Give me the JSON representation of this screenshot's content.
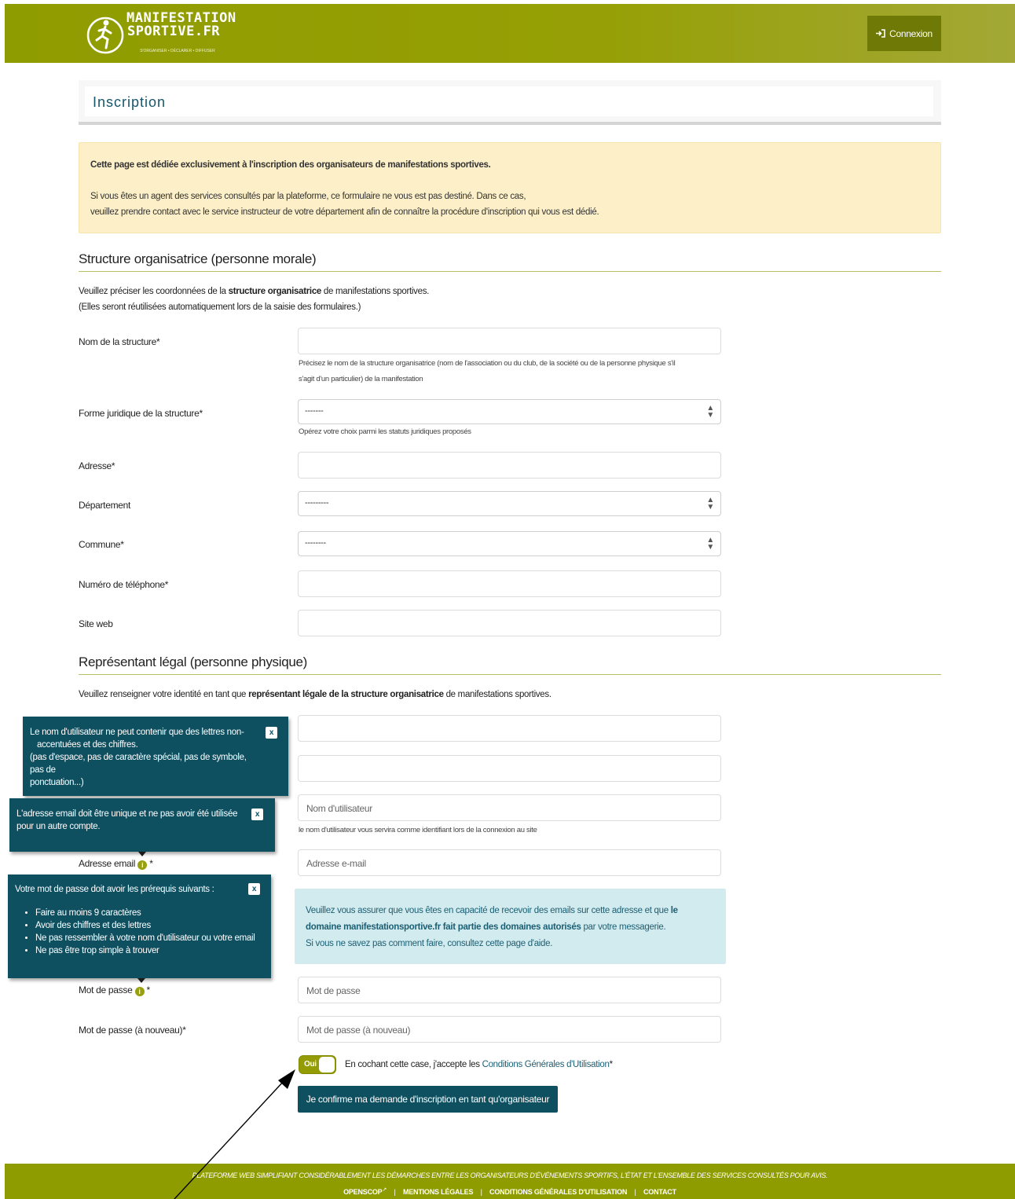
{
  "header": {
    "logo_line1": "MANIFESTATION",
    "logo_line2": "SPORTIVE.FR",
    "logo_tagline": "S'ORGANISER • DÉCLARER • DIFFUSER",
    "login_label": "Connexion",
    "login_icon": "sign-in-icon"
  },
  "page": {
    "title": "Inscription"
  },
  "alert": {
    "line1": "Cette page est dédiée exclusivement à l'inscription des organisateurs de manifestations sportives.",
    "line2": "Si vous êtes un agent des services consultés par la plateforme, ce formulaire ne vous est pas destiné. Dans ce cas,",
    "line3": "veuillez prendre contact avec le service instructeur de votre département afin de connaître la procédure d'inscription qui vous est dédié."
  },
  "structure": {
    "section_title": "Structure organisatrice (personne morale)",
    "intro_pre": "Veuillez préciser les coordonnées de la ",
    "intro_bold": "structure organisatrice",
    "intro_post": " de manifestations sportives.",
    "intro_line2": "(Elles seront réutilisées automatiquement lors de la saisie des formulaires.)",
    "nom_label": "Nom de la structure*",
    "nom_value": "",
    "nom_help_1": "Précisez le nom de la structure organisatrice (nom de l'association ou du club, de la société ou de la personne physique s'il",
    "nom_help_2": "s'agit d'un particulier) de la manifestation",
    "forme_label": "Forme juridique de la structure*",
    "forme_value": "-------",
    "forme_help": "Opérez votre choix parmi les statuts juridiques proposés",
    "adresse_label": "Adresse*",
    "adresse_value": "",
    "departement_label": "Département",
    "departement_value": "---------",
    "commune_label": "Commune*",
    "commune_value": "--------",
    "telephone_label": "Numéro de téléphone*",
    "telephone_value": "",
    "site_label": "Site web",
    "site_value": ""
  },
  "representant": {
    "section_title": "Représentant légal (personne physique)",
    "intro_pre": "Veuillez renseigner votre identité en tant que ",
    "intro_bold": "représentant légale de la structure organisatrice",
    "intro_post": " de manifestations sportives.",
    "field1_value": "",
    "field2_value": "",
    "username_placeholder": "Nom d'utilisateur",
    "username_help": "le nom d'utilisateur vous servira comme identifiant lors de la connexion au site",
    "email_label": "Adresse email",
    "email_required": "*",
    "email_placeholder": "Adresse e-mail",
    "info_icon": "info-icon",
    "info_pre": "Veuillez vous assurer que vous êtes en capacité de recevoir des emails sur cette adresse et que ",
    "info_bold1": "le",
    "info_bold2": "domaine manifestationsportive.fr fait partie des domaines autorisés",
    "info_mid": " par votre messagerie.",
    "info_line3": "Si vous ne savez pas comment faire, consultez cette page d'aide.",
    "password_label": "Mot de passe",
    "password_required": "*",
    "password_placeholder": "Mot de passe",
    "password2_label": "Mot de passe (à nouveau)*",
    "password2_placeholder": "Mot de passe (à nouveau)",
    "toggle_label": "Oui",
    "cgu_pre": "En cochant cette case, j'accepte les ",
    "cgu_link": "Conditions Générales d'Utilisation",
    "cgu_post": "*",
    "submit_label": "Je confirme ma demande d'inscription en tant qu'organisateur"
  },
  "tooltips": {
    "username_line1": "Le nom d'utilisateur ne peut contenir que des lettres non-",
    "username_line2": "accentuées et des chiffres.",
    "username_line3": "(pas d'espace, pas de caractère spécial, pas de symbole, pas de",
    "username_line4": "ponctuation...)",
    "email_line1": "L'adresse email doit être unique et ne pas avoir été utilisée",
    "email_line2": "pour un autre compte.",
    "password_title": "Votre mot de passe doit avoir les prérequis suivants :",
    "password_rules": [
      "Faire au moins 9 caractères",
      "Avoir des chiffres et des lettres",
      "Ne pas ressembler à votre nom d'utilisateur ou votre email",
      "Ne pas être trop simple à trouver"
    ],
    "close_label": "x"
  },
  "footer": {
    "tagline": "PLATEFORME WEB SIMPLIFIANT CONSIDÉRABLEMENT LES DÉMARCHES ENTRE LES ORGANISATEURS D'ÉVÉNEMENTS SPORTIFS, L'ÉTAT ET L'ENSEMBLE DES SERVICES CONSULTÉS POUR AVIS.",
    "links": [
      "OPENSCOP",
      "MENTIONS LÉGALES",
      "CONDITIONS GÉNÉRALES D'UTILISATION",
      "CONTACT"
    ],
    "separator": "|",
    "external_icon": "external-link-icon"
  },
  "colors": {
    "brand_green": "#8f9c00",
    "dark_teal": "#0e4f60",
    "alert_bg": "#fdf0c8",
    "info_bg": "#d2ebee"
  }
}
